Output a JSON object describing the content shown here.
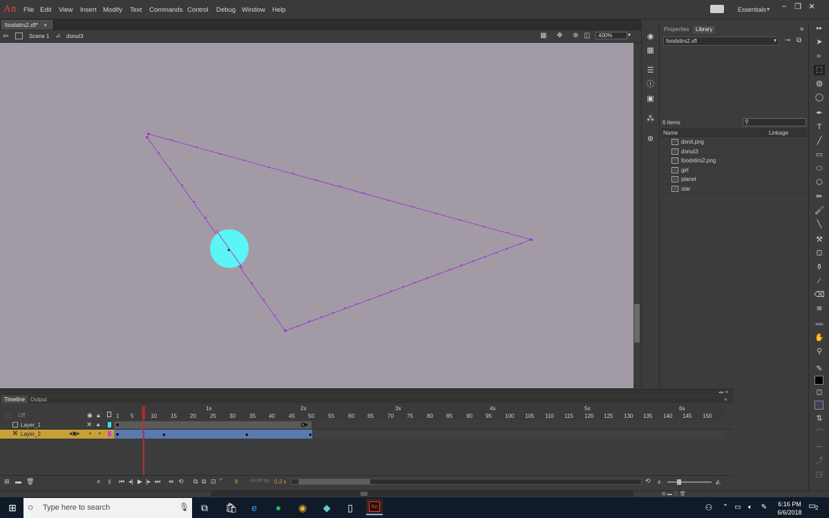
{
  "app": {
    "logo": "An"
  },
  "menu": [
    "File",
    "Edit",
    "View",
    "Insert",
    "Modify",
    "Text",
    "Commands",
    "Control",
    "Debug",
    "Window",
    "Help"
  ],
  "workspace": {
    "label": "Essentials"
  },
  "document": {
    "tab_label": "foodstirs2.xfl*",
    "scene_label": "Scene 1",
    "symbol_label": "donut3",
    "zoom": "400%"
  },
  "panels": {
    "properties_tab": "Properties",
    "library_tab": "Library"
  },
  "library": {
    "doc_select": "foodstirs2.xfl",
    "items_count": "6 items",
    "col_name": "Name",
    "col_linkage": "Linkage",
    "items": [
      "donit.png",
      "donut3",
      "foodstirs2.png",
      "girl",
      "planet",
      "star"
    ]
  },
  "timeline": {
    "tab_timeline": "Timeline",
    "tab_output": "Output",
    "off_label": "Off",
    "seconds": [
      "1s",
      "2s",
      "3s",
      "4s",
      "5s",
      "6s"
    ],
    "frames": [
      "1",
      "5",
      "10",
      "15",
      "20",
      "25",
      "30",
      "35",
      "40",
      "45",
      "50",
      "55",
      "60",
      "65",
      "70",
      "75",
      "80",
      "85",
      "90",
      "95",
      "100",
      "105",
      "110",
      "115",
      "120",
      "125",
      "130",
      "135",
      "140",
      "145",
      "150"
    ],
    "layers": [
      "Layer_1",
      "Layer_2"
    ],
    "current_frame": "8",
    "fps": "24.00 fps",
    "time": "0.3 s"
  },
  "taskbar": {
    "search_placeholder": "Type here to search",
    "time": "6:16 PM",
    "date": "6/6/2018",
    "notifications": "2"
  },
  "colors": {
    "stage": "#a29ba6",
    "circle": "#5cf4f7",
    "path": "#a03cd0",
    "layer2_span": "#5a7ab0",
    "layer2_label": "#c8a236"
  }
}
